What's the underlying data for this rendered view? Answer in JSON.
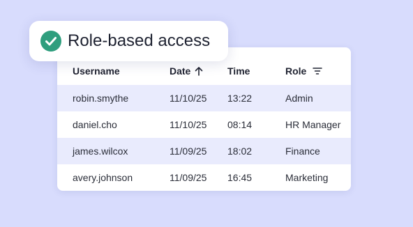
{
  "badge": {
    "label": "Role-based access",
    "accent": "#2f9e7e"
  },
  "table": {
    "headers": {
      "username": "Username",
      "date": "Date",
      "time": "Time",
      "role": "Role"
    },
    "sort_icon": "arrow-up-icon",
    "filter_icon": "filter-icon",
    "highlight_color": "#e9ebfd",
    "rows": [
      {
        "username": "robin.smythe",
        "date": "11/10/25",
        "time": "13:22",
        "role": "Admin"
      },
      {
        "username": "daniel.cho",
        "date": "11/10/25",
        "time": "08:14",
        "role": "HR Manager"
      },
      {
        "username": "james.wilcox",
        "date": "11/09/25",
        "time": "18:02",
        "role": "Finance"
      },
      {
        "username": "avery.johnson",
        "date": "11/09/25",
        "time": "16:45",
        "role": "Marketing"
      }
    ]
  }
}
